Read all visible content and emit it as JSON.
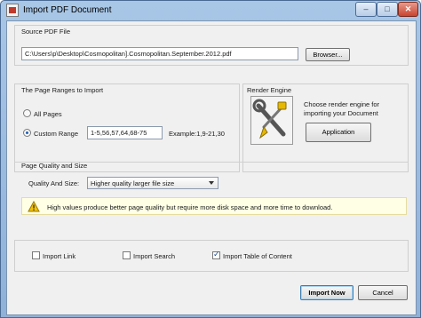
{
  "window": {
    "title": "Import PDF Document",
    "controls": {
      "minimize": "–",
      "maximize": "□",
      "close": "✕"
    }
  },
  "source": {
    "section_title": "Source PDF File",
    "path_value": "C:\\Users\\p\\Desktop\\Cosmopolitan].Cosmopolitan.September.2012.pdf",
    "browse_label": "Browser..."
  },
  "page_ranges": {
    "section_title": "The Page Ranges to Import",
    "all_pages_label": "All Pages",
    "custom_range_label": "Custom Range",
    "custom_range_value": "1-5,56,57,64,68-75",
    "example_text": "Example:1,9-21,30",
    "selected": "custom_range"
  },
  "render_engine": {
    "section_title": "Render Engine",
    "description_line1": "Choose render engine for",
    "description_line2": "importing your Document",
    "button_label": "Application",
    "image_icon": "tools-wrench-screwdriver-icon"
  },
  "quality": {
    "section_title": "Page Quality and Size",
    "label": "Quality And Size:",
    "selected_option": "Higher quality larger file size",
    "info_text": "High values produce better page quality but require more disk space and more time to download.",
    "info_icon": "warning-icon"
  },
  "options": {
    "import_link": {
      "label": "Import Link",
      "checked": false
    },
    "import_search": {
      "label": "Import Search",
      "checked": false
    },
    "import_toc": {
      "label": "Import Table of Content",
      "checked": true
    }
  },
  "footer": {
    "import_label": "Import Now",
    "cancel_label": "Cancel"
  }
}
